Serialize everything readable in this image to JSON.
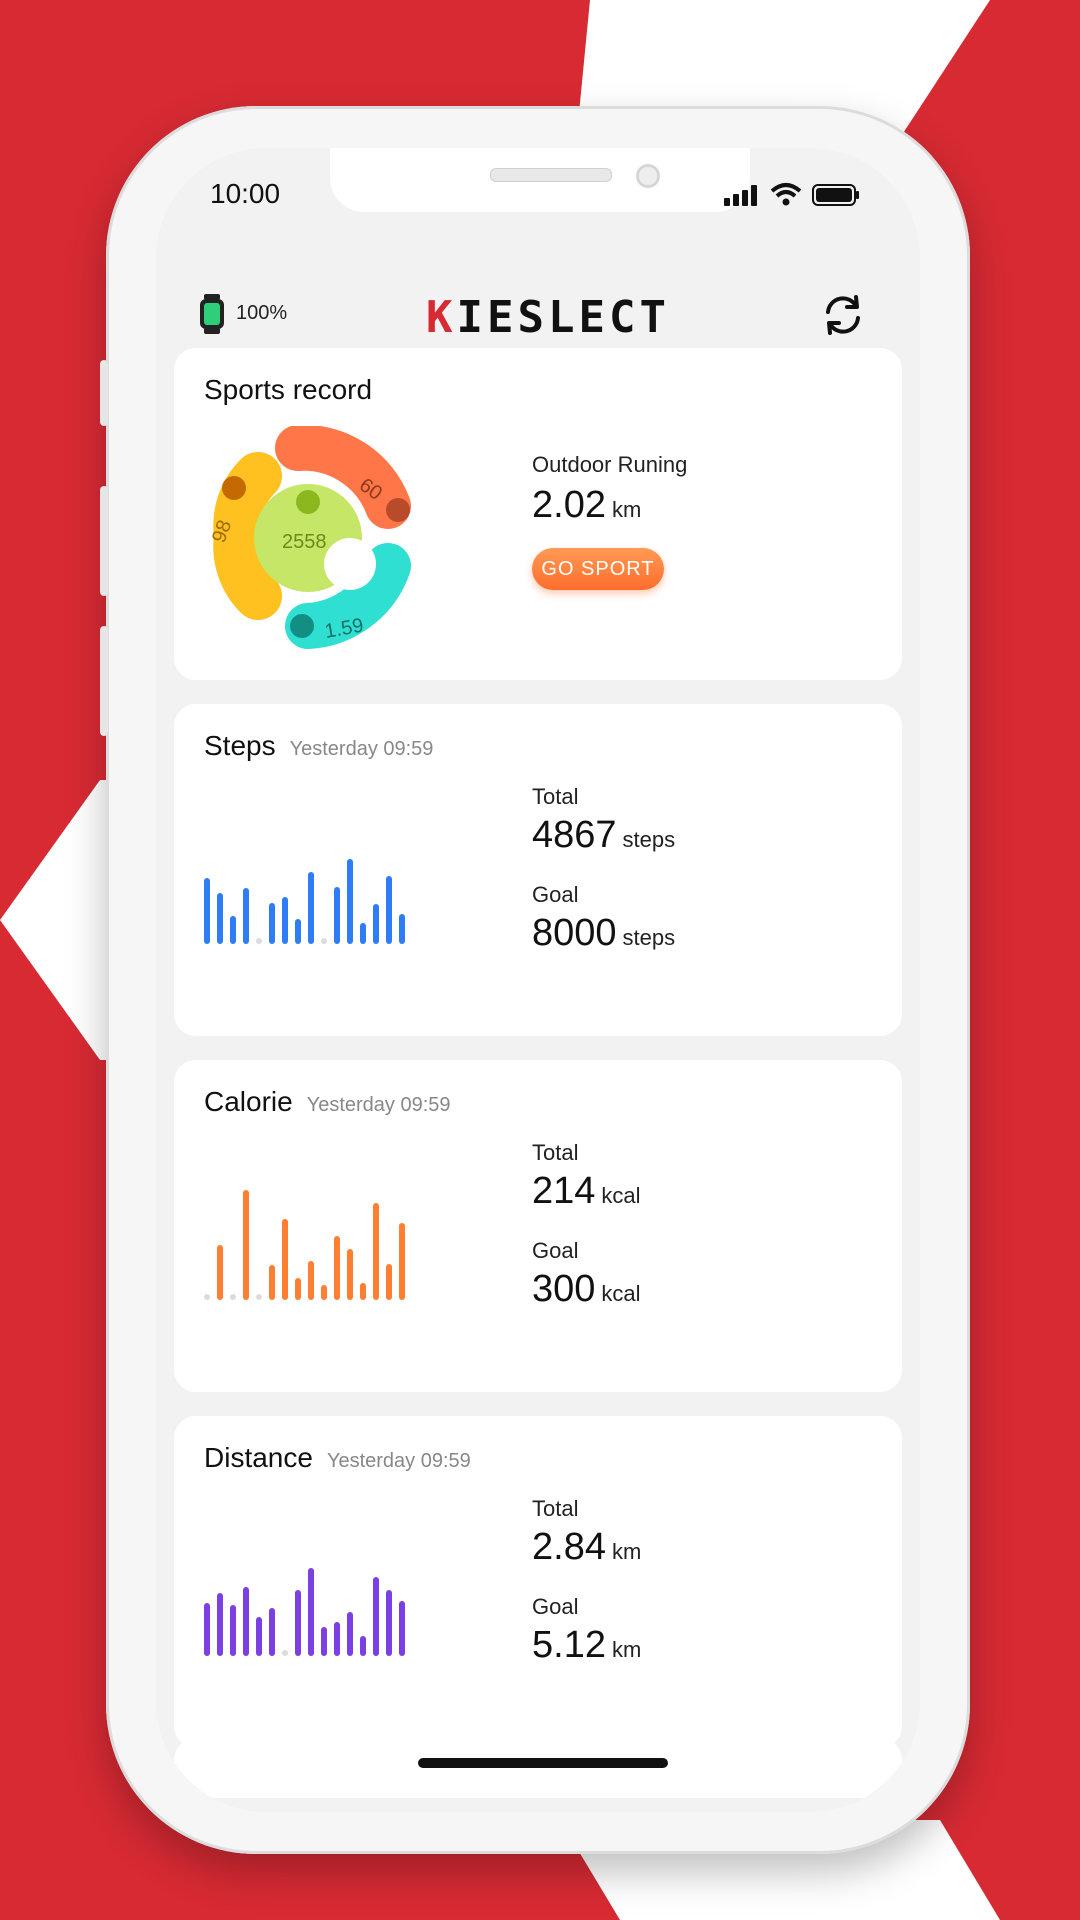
{
  "status": {
    "time": "10:00"
  },
  "header": {
    "battery": "100%",
    "logo_k": "K",
    "logo_rest": "IESLECT"
  },
  "sports": {
    "title": "Sports record",
    "ring_left": "98",
    "ring_top": "60",
    "ring_bottom": "1.59",
    "ring_center": "2558",
    "activity": "Outdoor Runing",
    "distance": "2.02",
    "distance_unit": "km",
    "button": "GO SPORT"
  },
  "steps": {
    "title": "Steps",
    "time": "Yesterday 09:59",
    "total_label": "Total",
    "total": "4867",
    "total_unit": "steps",
    "goal_label": "Goal",
    "goal": "8000",
    "goal_unit": "steps",
    "color": "#2e7cf6",
    "bars": [
      60,
      46,
      25,
      51,
      0,
      37,
      43,
      23,
      65,
      0,
      52,
      77,
      19,
      36,
      62,
      27
    ]
  },
  "calorie": {
    "title": "Calorie",
    "time": "Yesterday 09:59",
    "total_label": "Total",
    "total": "214",
    "total_unit": "kcal",
    "goal_label": "Goal",
    "goal": "300",
    "goal_unit": "kcal",
    "color": "#ff7f32",
    "bars": [
      0,
      50,
      0,
      100,
      0,
      32,
      74,
      20,
      35,
      14,
      58,
      46,
      15,
      88,
      33,
      70
    ]
  },
  "distance": {
    "title": "Distance",
    "time": "Yesterday 09:59",
    "total_label": "Total",
    "total": "2.84",
    "total_unit": "km",
    "goal_label": "Goal",
    "goal": "5.12",
    "goal_unit": "km",
    "color": "#7b3fe4",
    "bars": [
      48,
      57,
      46,
      63,
      35,
      44,
      0,
      60,
      80,
      26,
      31,
      40,
      18,
      72,
      60,
      50
    ]
  }
}
